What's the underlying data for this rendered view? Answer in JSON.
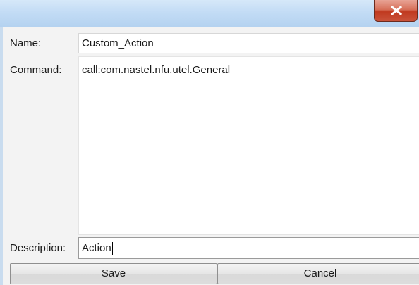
{
  "window": {
    "close_icon": "close-icon"
  },
  "form": {
    "name_label": "Name:",
    "name_value": "Custom_Action",
    "command_label": "Command:",
    "command_value": "call:com.nastel.nfu.utel.General",
    "description_label": "Description:",
    "description_value": "Action"
  },
  "buttons": {
    "save": "Save",
    "cancel": "Cancel"
  },
  "colors": {
    "titlebar": "#c3dcf5",
    "close_button": "#c0391f",
    "dialog_bg": "#f3f3f3"
  }
}
